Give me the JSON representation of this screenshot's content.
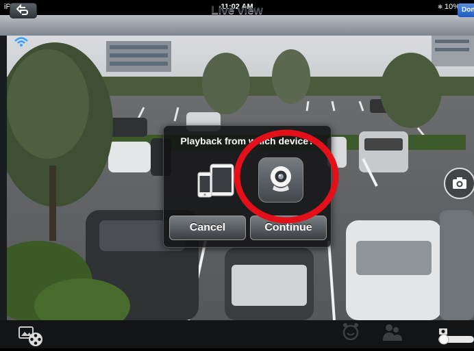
{
  "status_bar": {
    "device": "iPad",
    "time": "11:02 AM",
    "battery": "10%"
  },
  "navbar": {
    "title": "Live view",
    "done_label": "Done"
  },
  "dialog": {
    "title": "Playback from which device?",
    "cancel_label": "Cancel",
    "continue_label": "Continue"
  },
  "icons": {
    "wifi": "wifi-icon",
    "back": "back-arrow-icon",
    "local_devices": "phone-tablet-icon",
    "camera_device": "webcam-icon",
    "snapshot": "camera-icon",
    "gallery": "gallery-film-icon",
    "motion_timer": "alarm-clock-icon",
    "person_detect": "person-icon",
    "mini_camera": "camera-icon",
    "toggle": "toggle-switch-icon"
  },
  "colors": {
    "annotation_ring": "#e3101a",
    "accent_done": "#1f5bc4",
    "wifi": "#3aa0ff"
  }
}
